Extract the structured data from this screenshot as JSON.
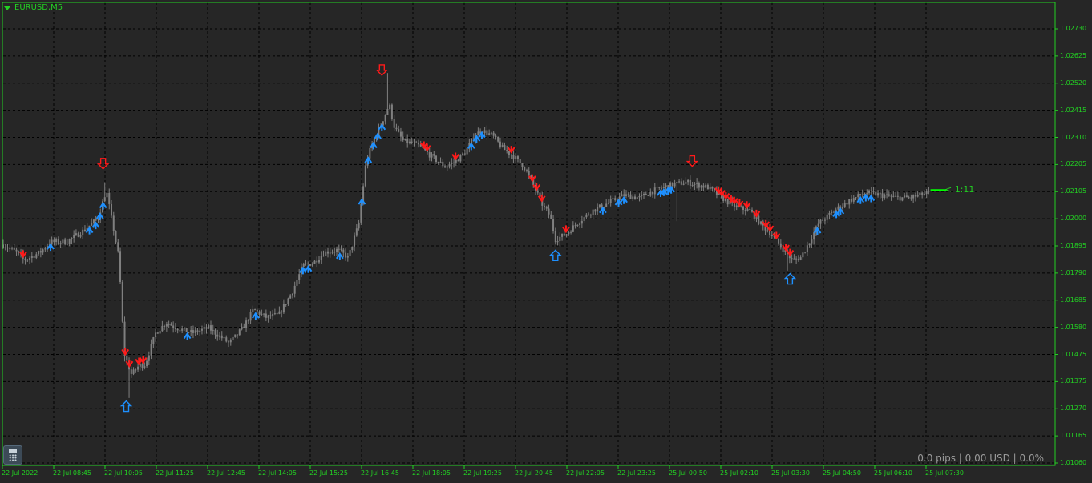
{
  "symbol": {
    "label": "EURUSD,M5"
  },
  "countdown": {
    "label": "< 1:11"
  },
  "status": {
    "readout": "0.0 pips | 0.00 USD | 0.0%"
  },
  "icons": {
    "calculator": "calculator-icon",
    "timeframe_menu": "chevron-down-icon"
  },
  "colors": {
    "background": "#262626",
    "grid": "#000000",
    "axis_text": "#23d023",
    "candle": "#808080",
    "buy_arrow": "#1e90ff",
    "sell_arrow": "#ff1a1a",
    "bid_line": "#00ff00"
  },
  "chart_data": {
    "type": "candlestick",
    "symbol": "EURUSD",
    "timeframe": "M5",
    "ylim": [
      1.0106,
      1.0283
    ],
    "grid": true,
    "y_ticks": [
      "1.02730",
      "1.02625",
      "1.02520",
      "1.02415",
      "1.02310",
      "1.02205",
      "1.02105",
      "1.02000",
      "1.01895",
      "1.01790",
      "1.01685",
      "1.01580",
      "1.01475",
      "1.01375",
      "1.01270",
      "1.01165",
      "1.01060"
    ],
    "x_ticks": [
      "22 Jul 2022",
      "22 Jul 08:45",
      "22 Jul 10:05",
      "22 Jul 11:25",
      "22 Jul 12:45",
      "22 Jul 14:05",
      "22 Jul 15:25",
      "22 Jul 16:45",
      "22 Jul 18:05",
      "22 Jul 19:25",
      "22 Jul 20:45",
      "22 Jul 22:05",
      "22 Jul 23:25",
      "25 Jul 00:50",
      "25 Jul 02:10",
      "25 Jul 03:30",
      "25 Jul 04:50",
      "25 Jul 06:10",
      "25 Jul 07:30"
    ],
    "price_path": [
      [
        0,
        1.019
      ],
      [
        0.013,
        1.0187
      ],
      [
        0.02,
        1.0184
      ],
      [
        0.035,
        1.0187
      ],
      [
        0.045,
        1.0191
      ],
      [
        0.06,
        1.0191
      ],
      [
        0.075,
        1.0195
      ],
      [
        0.09,
        1.02
      ],
      [
        0.098,
        1.0211
      ],
      [
        0.102,
        1.0202
      ],
      [
        0.11,
        1.0185
      ],
      [
        0.115,
        1.0148
      ],
      [
        0.122,
        1.014
      ],
      [
        0.128,
        1.0143
      ],
      [
        0.135,
        1.0144
      ],
      [
        0.145,
        1.0156
      ],
      [
        0.155,
        1.016
      ],
      [
        0.165,
        1.0158
      ],
      [
        0.18,
        1.0156
      ],
      [
        0.195,
        1.0158
      ],
      [
        0.215,
        1.0152
      ],
      [
        0.228,
        1.0158
      ],
      [
        0.238,
        1.0165
      ],
      [
        0.25,
        1.0162
      ],
      [
        0.262,
        1.0163
      ],
      [
        0.275,
        1.0172
      ],
      [
        0.285,
        1.0182
      ],
      [
        0.295,
        1.0183
      ],
      [
        0.305,
        1.0187
      ],
      [
        0.318,
        1.0188
      ],
      [
        0.328,
        1.0185
      ],
      [
        0.338,
        1.0198
      ],
      [
        0.345,
        1.0222
      ],
      [
        0.352,
        1.023
      ],
      [
        0.36,
        1.0237
      ],
      [
        0.367,
        1.0244
      ],
      [
        0.372,
        1.0235
      ],
      [
        0.38,
        1.023
      ],
      [
        0.395,
        1.0228
      ],
      [
        0.41,
        1.0223
      ],
      [
        0.42,
        1.022
      ],
      [
        0.43,
        1.0222
      ],
      [
        0.44,
        1.0226
      ],
      [
        0.448,
        1.0232
      ],
      [
        0.455,
        1.0234
      ],
      [
        0.465,
        1.0232
      ],
      [
        0.475,
        1.0227
      ],
      [
        0.485,
        1.0224
      ],
      [
        0.495,
        1.022
      ],
      [
        0.505,
        1.0212
      ],
      [
        0.513,
        1.0205
      ],
      [
        0.52,
        1.0201
      ],
      [
        0.525,
        1.0192
      ],
      [
        0.535,
        1.0194
      ],
      [
        0.545,
        1.0198
      ],
      [
        0.56,
        1.0203
      ],
      [
        0.575,
        1.0206
      ],
      [
        0.59,
        1.0209
      ],
      [
        0.605,
        1.0208
      ],
      [
        0.62,
        1.0211
      ],
      [
        0.635,
        1.0213
      ],
      [
        0.65,
        1.0214
      ],
      [
        0.66,
        1.0213
      ],
      [
        0.67,
        1.0212
      ],
      [
        0.68,
        1.0209
      ],
      [
        0.69,
        1.0206
      ],
      [
        0.7,
        1.0204
      ],
      [
        0.71,
        1.0203
      ],
      [
        0.72,
        1.0198
      ],
      [
        0.73,
        1.0194
      ],
      [
        0.742,
        1.0188
      ],
      [
        0.75,
        1.0184
      ],
      [
        0.758,
        1.0185
      ],
      [
        0.765,
        1.019
      ],
      [
        0.775,
        1.0198
      ],
      [
        0.79,
        1.0203
      ],
      [
        0.805,
        1.0207
      ],
      [
        0.82,
        1.021
      ],
      [
        0.835,
        1.0209
      ],
      [
        0.85,
        1.0208
      ],
      [
        0.862,
        1.0208
      ],
      [
        0.872,
        1.0209
      ],
      [
        0.88,
        1.021
      ]
    ],
    "spikes": [
      {
        "x": 0.097,
        "high": 1.0214
      },
      {
        "x": 0.119,
        "low": 1.0131
      },
      {
        "x": 0.366,
        "high": 1.0256
      },
      {
        "x": 0.525,
        "low": 1.019
      },
      {
        "x": 0.64,
        "low": 1.0199
      },
      {
        "x": 0.745,
        "low": 1.018
      }
    ],
    "buy_signals": [
      0.045,
      0.082,
      0.088,
      0.092,
      0.095,
      0.175,
      0.24,
      0.285,
      0.29,
      0.32,
      0.341,
      0.347,
      0.352,
      0.356,
      0.36,
      0.445,
      0.45,
      0.455,
      0.57,
      0.585,
      0.59,
      0.625,
      0.628,
      0.632,
      0.635,
      0.774,
      0.792,
      0.796,
      0.815,
      0.82,
      0.825
    ],
    "sell_signals": [
      0.019,
      0.116,
      0.12,
      0.129,
      0.133,
      0.4,
      0.403,
      0.43,
      0.483,
      0.503,
      0.507,
      0.512,
      0.535,
      0.68,
      0.683,
      0.687,
      0.692,
      0.695,
      0.7,
      0.707,
      0.716,
      0.725,
      0.729,
      0.735,
      0.744,
      0.748
    ],
    "major_signals": [
      {
        "type": "sell",
        "x": 0.095,
        "price": 1.0221
      },
      {
        "type": "sell",
        "x": 0.36,
        "price": 1.0257
      },
      {
        "type": "sell",
        "x": 0.655,
        "price": 1.0222
      },
      {
        "type": "buy",
        "x": 0.117,
        "price": 1.0128
      },
      {
        "type": "buy",
        "x": 0.525,
        "price": 1.0186
      },
      {
        "type": "buy",
        "x": 0.748,
        "price": 1.0177
      }
    ],
    "bid": 1.0211
  }
}
